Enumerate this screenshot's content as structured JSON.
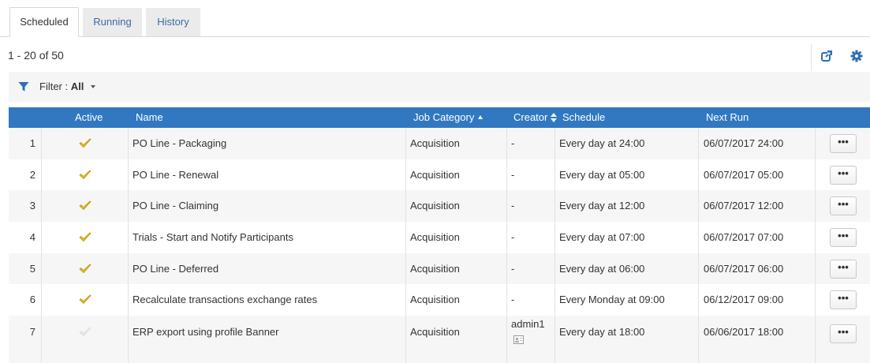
{
  "tabs": [
    {
      "label": "Scheduled",
      "active": true
    },
    {
      "label": "Running",
      "active": false
    },
    {
      "label": "History",
      "active": false
    }
  ],
  "results": {
    "count_text": "1 - 20 of 50"
  },
  "toolbar": {
    "export_icon": "export-icon",
    "settings_icon": "gear-icon"
  },
  "filter": {
    "label": "Filter : ",
    "value": "All"
  },
  "table": {
    "columns": {
      "active": "Active",
      "name": "Name",
      "category": "Job Category",
      "creator": "Creator",
      "schedule": "Schedule",
      "next_run": "Next Run"
    },
    "actions_label": "•••",
    "rows": [
      {
        "num": "1",
        "active": true,
        "name": "PO Line - Packaging",
        "category": "Acquisition",
        "creator": "-",
        "schedule": "Every day at 24:00",
        "next_run": "06/07/2017 24:00"
      },
      {
        "num": "2",
        "active": true,
        "name": "PO Line - Renewal",
        "category": "Acquisition",
        "creator": "-",
        "schedule": "Every day at 05:00",
        "next_run": "06/07/2017 05:00"
      },
      {
        "num": "3",
        "active": true,
        "name": "PO Line - Claiming",
        "category": "Acquisition",
        "creator": "-",
        "schedule": "Every day at 12:00",
        "next_run": "06/07/2017 12:00"
      },
      {
        "num": "4",
        "active": true,
        "name": "Trials - Start and Notify Participants",
        "category": "Acquisition",
        "creator": "-",
        "schedule": "Every day at 07:00",
        "next_run": "06/07/2017 07:00"
      },
      {
        "num": "5",
        "active": true,
        "name": "PO Line - Deferred",
        "category": "Acquisition",
        "creator": "-",
        "schedule": "Every day at 06:00",
        "next_run": "06/07/2017 06:00"
      },
      {
        "num": "6",
        "active": true,
        "name": "Recalculate transactions exchange rates",
        "category": "Acquisition",
        "creator": "-",
        "schedule": "Every Monday at 09:00",
        "next_run": "06/12/2017 09:00"
      },
      {
        "num": "7",
        "active": false,
        "name": "ERP export using profile Banner",
        "category": "Acquisition",
        "creator": "admin1",
        "schedule": "Every day at 18:00",
        "next_run": "06/06/2017 18:00"
      }
    ]
  },
  "colors": {
    "header_bg": "#3178c1",
    "tab_link": "#3a6aa9",
    "check_active": "#e8c21a",
    "check_inactive": "#e6e6e6",
    "icon_blue": "#2f6fb5"
  }
}
